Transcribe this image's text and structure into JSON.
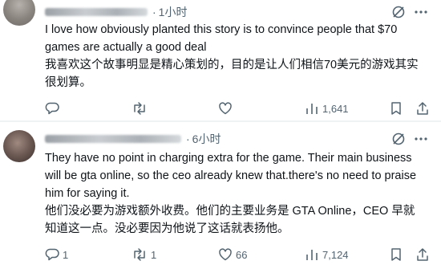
{
  "posts": [
    {
      "time": "1小时",
      "text_en": "I love how obviously planted this story is to convince people that $70 games are actually a good deal",
      "text_zh": "我喜欢这个故事明显是精心策划的，目的是让人们相信70美元的游戏其实很划算。",
      "actions": {
        "replies": "",
        "reposts": "",
        "likes": "",
        "views": "1,641"
      }
    },
    {
      "time": "6小时",
      "text_en": "They have no point in charging extra for the game. Their main business will be gta online, so the ceo already knew that.there's no need to praise him for saying it.",
      "text_zh": "他们没必要为游戏额外收费。他们的主要业务是 GTA Online，CEO 早就知道这一点。没必要因为他说了这话就表扬他。",
      "actions": {
        "replies": "1",
        "reposts": "1",
        "likes": "66",
        "views": "7,124"
      }
    }
  ],
  "separator": "·",
  "icons": [
    "grok-icon",
    "more-icon",
    "reply-icon",
    "repost-icon",
    "like-icon",
    "views-icon",
    "bookmark-icon",
    "share-icon"
  ],
  "colors": {
    "text": "#0f1419",
    "muted": "#536471",
    "divider": "#eff3f4"
  }
}
